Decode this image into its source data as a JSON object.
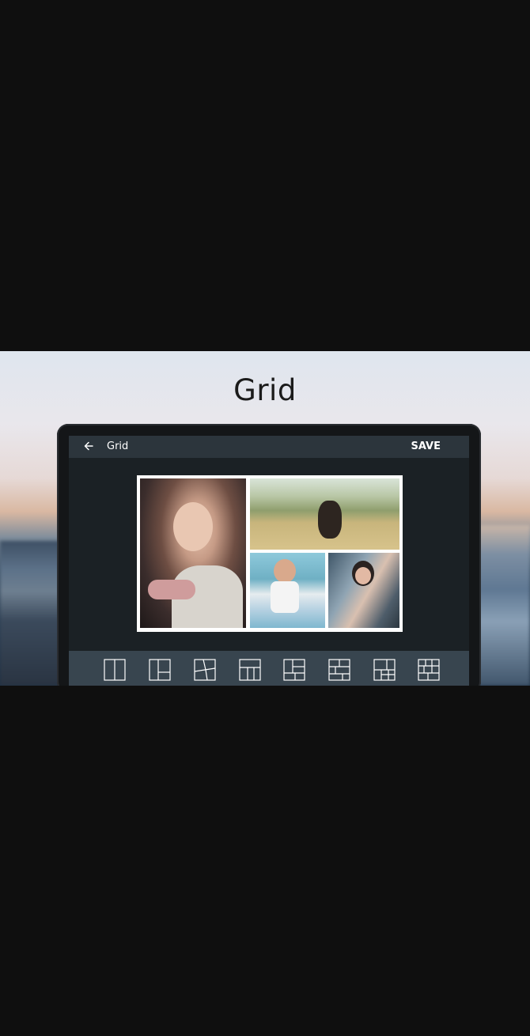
{
  "banner": {
    "title": "Grid"
  },
  "appbar": {
    "title": "Grid",
    "save_label": "SAVE",
    "back_icon": "arrow-left-icon"
  },
  "collage": {
    "background_color": "#ffffff",
    "photos": [
      {
        "name": "portrait-woman-sweater"
      },
      {
        "name": "woman-sitting-field"
      },
      {
        "name": "woman-beach"
      },
      {
        "name": "woman-balcony"
      }
    ]
  },
  "toolbar": {
    "layouts": [
      "layout-2-vertical-icon",
      "layout-3-corner-icon",
      "layout-3-diagonal-icon",
      "layout-4-grid-icon",
      "layout-5-icon",
      "layout-5-brick-icon",
      "layout-6-icon",
      "layout-7-icon"
    ]
  }
}
